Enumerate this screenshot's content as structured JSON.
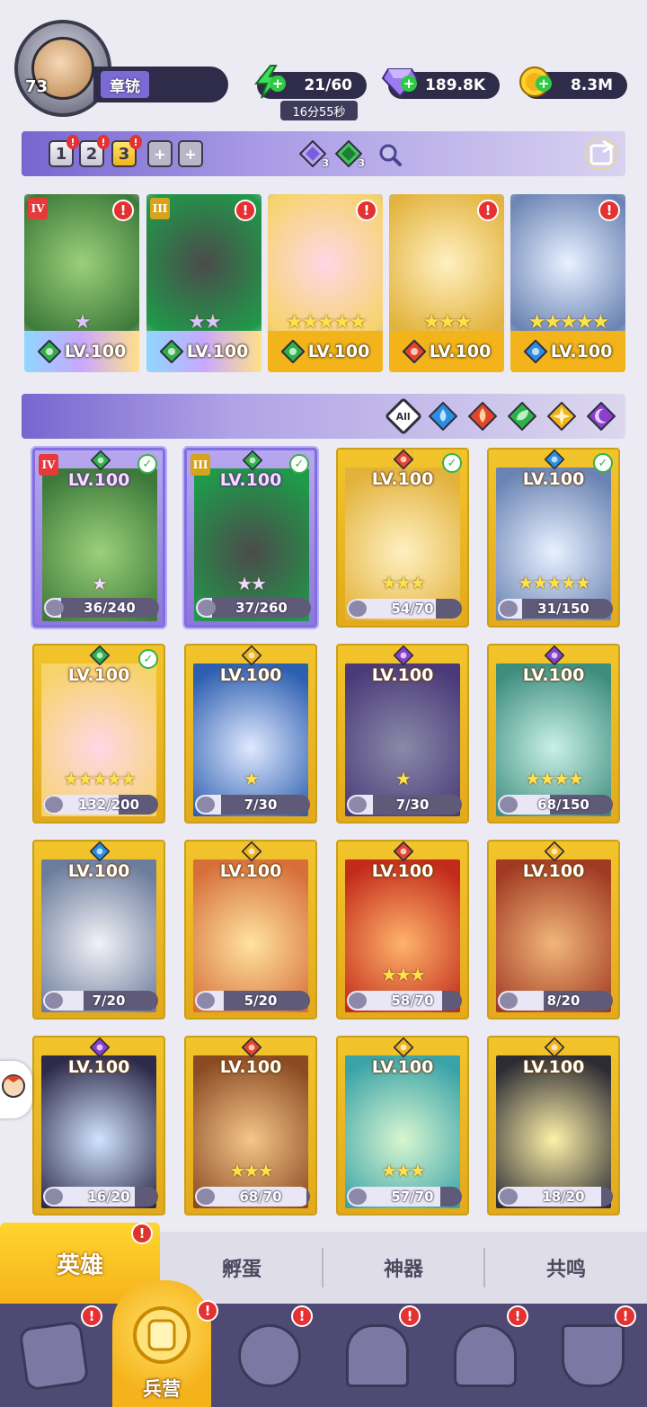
{
  "player": {
    "level": "73",
    "name": "章铳"
  },
  "resources": {
    "energy": "21/60",
    "energy_timer": "16分55秒",
    "gems": "189.8K",
    "gold": "8.3M"
  },
  "team_presets": {
    "slots": [
      "1",
      "2",
      "3"
    ],
    "active_slot": "3",
    "add_labels": [
      "+",
      "+"
    ],
    "purple_gem_count": "3",
    "green_gem_count": "3"
  },
  "team": [
    {
      "rank": "IV",
      "rank_color": "#e63a3a",
      "level": "LV.100",
      "element": "nature",
      "stars": "★",
      "art": "green-knight",
      "alert": "!"
    },
    {
      "rank": "III",
      "rank_color": "#d6a31c",
      "level": "LV.100",
      "element": "nature",
      "stars": "★★",
      "art": "dark-beast",
      "alert": "!"
    },
    {
      "rank": "",
      "level": "LV.100",
      "element": "nature",
      "stars": "★★★★★",
      "art": "flower-girl",
      "alert": "!"
    },
    {
      "rank": "",
      "level": "LV.100",
      "element": "fire",
      "stars": "★★★",
      "art": "holy-priest",
      "alert": "!"
    },
    {
      "rank": "",
      "level": "LV.100",
      "element": "water",
      "stars": "★★★★★",
      "art": "cat-maid",
      "alert": "!"
    }
  ],
  "filters": {
    "all_label": "All",
    "elements": [
      "water",
      "fire",
      "nature",
      "light",
      "dark"
    ]
  },
  "heroes": [
    {
      "level": "LV.100",
      "element": "nature",
      "shards": "36/240",
      "progress": 0.15,
      "stars": "★",
      "rank": "IV",
      "checked": true,
      "rare": true,
      "art": "green-knight"
    },
    {
      "level": "LV.100",
      "element": "nature",
      "shards": "37/260",
      "progress": 0.14,
      "stars": "★★",
      "rank": "III",
      "checked": true,
      "rare": true,
      "art": "dark-beast"
    },
    {
      "level": "LV.100",
      "element": "fire",
      "shards": "54/70",
      "progress": 0.77,
      "stars": "★★★",
      "checked": true,
      "art": "holy-priest"
    },
    {
      "level": "LV.100",
      "element": "water",
      "shards": "31/150",
      "progress": 0.21,
      "stars": "★★★★★",
      "checked": true,
      "art": "cat-maid"
    },
    {
      "level": "LV.100",
      "element": "nature",
      "shards": "132/200",
      "progress": 0.66,
      "stars": "★★★★★",
      "checked": true,
      "art": "flower-girl"
    },
    {
      "level": "LV.100",
      "element": "light",
      "shards": "7/30",
      "progress": 0.23,
      "stars": "★",
      "art": "ice-bear"
    },
    {
      "level": "LV.100",
      "element": "dark",
      "shards": "7/30",
      "progress": 0.23,
      "stars": "★",
      "art": "old-sage"
    },
    {
      "level": "LV.100",
      "element": "dark",
      "shards": "68/150",
      "progress": 0.45,
      "stars": "★★★★",
      "art": "ghost-girl"
    },
    {
      "level": "LV.100",
      "element": "water",
      "shards": "7/20",
      "progress": 0.35,
      "stars": "",
      "art": "white-hair"
    },
    {
      "level": "LV.100",
      "element": "light",
      "shards": "5/20",
      "progress": 0.25,
      "stars": "",
      "art": "gold-hat"
    },
    {
      "level": "LV.100",
      "element": "fire",
      "shards": "58/70",
      "progress": 0.83,
      "stars": "★★★",
      "art": "fire-girl"
    },
    {
      "level": "LV.100",
      "element": "light",
      "shards": "8/20",
      "progress": 0.4,
      "stars": "",
      "art": "spartan"
    },
    {
      "level": "LV.100",
      "element": "dark",
      "shards": "16/20",
      "progress": 0.8,
      "stars": "",
      "art": "dark-swordsman"
    },
    {
      "level": "LV.100",
      "element": "fire",
      "shards": "68/70",
      "progress": 0.97,
      "stars": "★★★",
      "art": "cowboy"
    },
    {
      "level": "LV.100",
      "element": "light",
      "shards": "57/70",
      "progress": 0.81,
      "stars": "★★★",
      "art": "elf-girl"
    },
    {
      "level": "LV.100",
      "element": "light",
      "shards": "18/20",
      "progress": 0.9,
      "stars": "",
      "art": "penguin"
    }
  ],
  "sub_tabs": [
    {
      "label": "英雄",
      "active": true,
      "alert": "!"
    },
    {
      "label": "孵蛋",
      "active": false
    },
    {
      "label": "神器",
      "active": false
    },
    {
      "label": "共鸣",
      "active": false
    }
  ],
  "bottom_nav": [
    {
      "icon": "cards-icon",
      "label": "",
      "alert": "!"
    },
    {
      "icon": "barracks-icon",
      "label": "兵营",
      "alert": "!",
      "active": true
    },
    {
      "icon": "map-icon",
      "label": "",
      "alert": "!"
    },
    {
      "icon": "castle-icon",
      "label": "",
      "alert": "!"
    },
    {
      "icon": "mushroom-icon",
      "label": "",
      "alert": "!"
    },
    {
      "icon": "banner-icon",
      "label": "",
      "alert": "!"
    }
  ],
  "colors": {
    "accent_purple": "#7766cf",
    "card_gold": "#f2c42b",
    "alert_red": "#e53131",
    "nav_bg": "#4e4a73",
    "nature": "#2fb14a",
    "fire": "#e2462a",
    "water": "#2a8fe2",
    "light": "#f2b31b",
    "dark": "#8a3fcf"
  }
}
